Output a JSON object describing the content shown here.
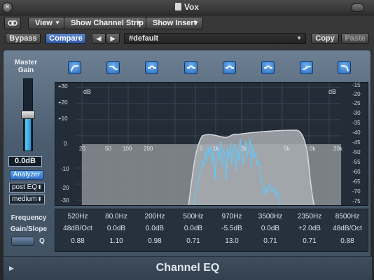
{
  "window": {
    "title": "Vox"
  },
  "toolbar": {
    "view_label": "View",
    "channel_strip_label": "Show Channel Strip",
    "insert_label": "Show Insert"
  },
  "controls": {
    "bypass_label": "Bypass",
    "compare_label": "Compare",
    "prev_label": "◀",
    "next_label": "▶",
    "preset_value": "#default",
    "copy_label": "Copy",
    "paste_label": "Paste"
  },
  "master": {
    "label_line1": "Master",
    "label_line2": "Gain",
    "value": "0.0dB",
    "level_fraction": 0.5,
    "analyzer_label": "Analyzer",
    "mode_value": "post EQ",
    "resolution_value": "medium"
  },
  "bands": [
    {
      "type": "lowcut-icon",
      "frequency": "520Hz",
      "gain_slope": "48dB/Oct",
      "q": "0.88"
    },
    {
      "type": "lowshelf-icon",
      "frequency": "80.0Hz",
      "gain_slope": "0.0dB",
      "q": "1.10"
    },
    {
      "type": "bell-icon",
      "frequency": "200Hz",
      "gain_slope": "0.0dB",
      "q": "0.98"
    },
    {
      "type": "bell-icon",
      "frequency": "500Hz",
      "gain_slope": "0.0dB",
      "q": "0.71"
    },
    {
      "type": "bell-icon",
      "frequency": "970Hz",
      "gain_slope": "-5.5dB",
      "q": "13.0"
    },
    {
      "type": "bell-icon",
      "frequency": "3500Hz",
      "gain_slope": "0.0dB",
      "q": "0.71"
    },
    {
      "type": "highshelf-icon",
      "frequency": "2350Hz",
      "gain_slope": "+2.0dB",
      "q": "0.71"
    },
    {
      "type": "highcut-icon",
      "frequency": "8500Hz",
      "gain_slope": "48dB/Oct",
      "q": "0.88"
    }
  ],
  "param_labels": {
    "frequency": "Frequency",
    "gain_slope": "Gain/Slope",
    "q": "Q"
  },
  "graph": {
    "left_unit": "dB",
    "right_unit": "dB",
    "left_scale": [
      "+30",
      "+20",
      "+10",
      "0",
      "-10",
      "-20",
      "-30"
    ],
    "right_scale": [
      "-15",
      "-20",
      "-25",
      "-30",
      "-35",
      "-40",
      "-45",
      "-50",
      "-55",
      "-60",
      "-65",
      "-70",
      "-75"
    ],
    "freq_ticks": [
      "20",
      "50",
      "100",
      "200",
      "500",
      "1k",
      "2k",
      "5k",
      "10k",
      "20k"
    ],
    "visible_freq_labels": [
      "20",
      "50",
      "100",
      "200",
      "5",
      "1k",
      "2k",
      "5k",
      "0k",
      "20k"
    ]
  },
  "footer": {
    "title": "Channel EQ"
  }
}
